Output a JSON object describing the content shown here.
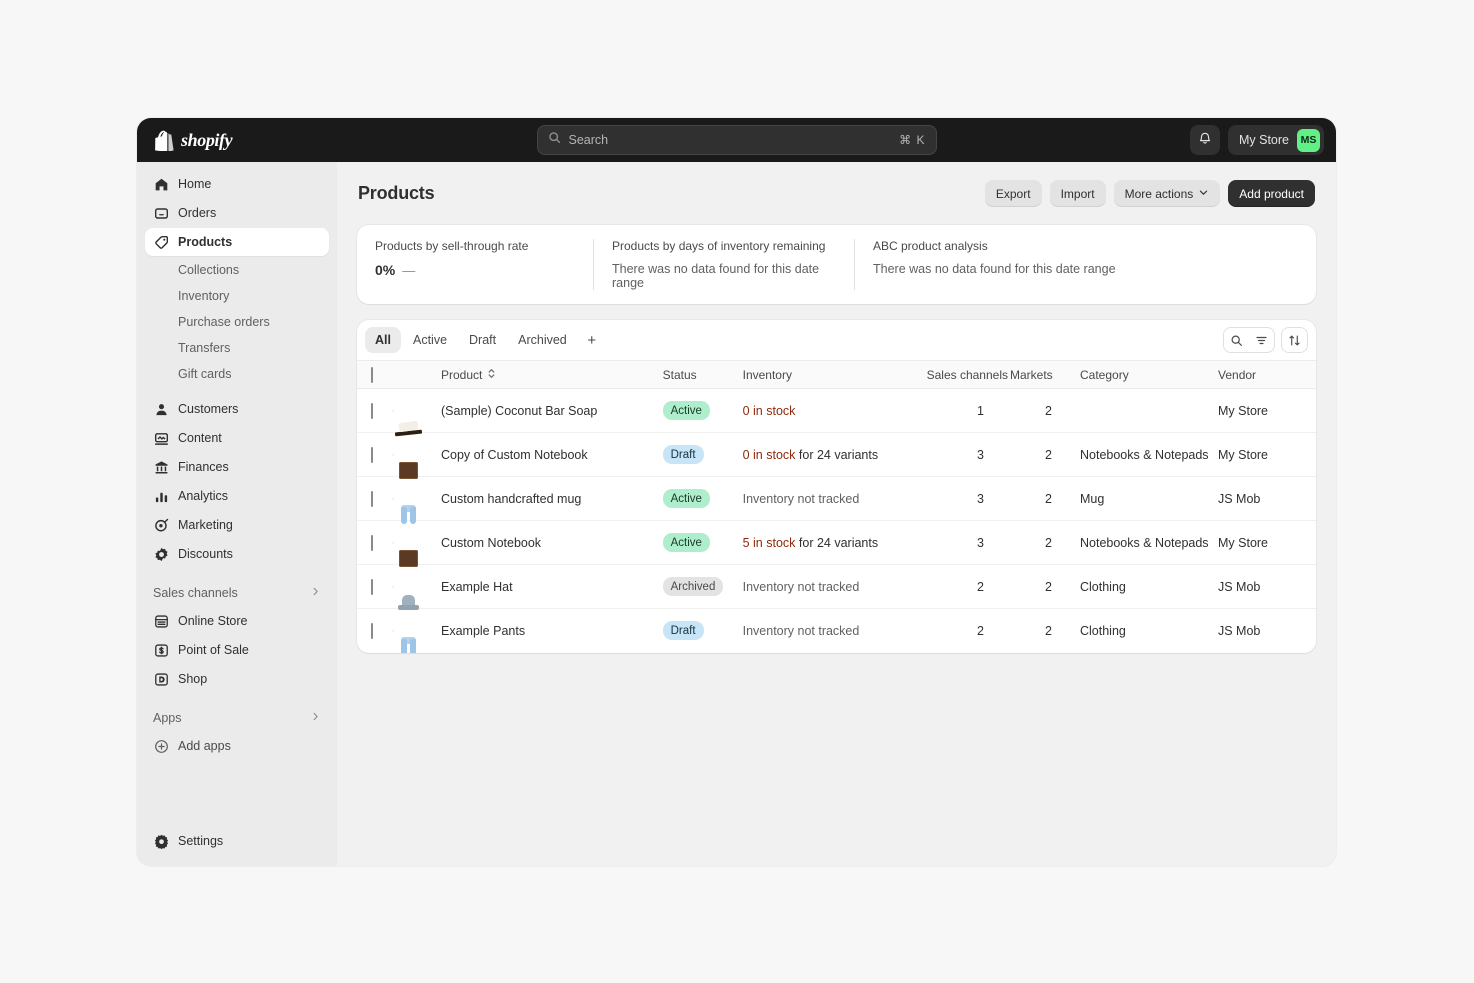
{
  "topbar": {
    "logo_text": "shopify",
    "search": {
      "placeholder": "Search",
      "shortcut": "⌘ K"
    },
    "store_name": "My Store",
    "store_initials": "MS"
  },
  "sidebar": {
    "primary": [
      {
        "label": "Home",
        "icon": "home-icon"
      },
      {
        "label": "Orders",
        "icon": "orders-icon"
      },
      {
        "label": "Products",
        "icon": "products-tag-icon",
        "active": true
      }
    ],
    "product_subitems": [
      {
        "label": "Collections"
      },
      {
        "label": "Inventory"
      },
      {
        "label": "Purchase orders"
      },
      {
        "label": "Transfers"
      },
      {
        "label": "Gift cards"
      }
    ],
    "secondary": [
      {
        "label": "Customers",
        "icon": "customers-icon"
      },
      {
        "label": "Content",
        "icon": "content-icon"
      },
      {
        "label": "Finances",
        "icon": "finances-bank-icon"
      },
      {
        "label": "Analytics",
        "icon": "analytics-bars-icon"
      },
      {
        "label": "Marketing",
        "icon": "marketing-target-icon"
      },
      {
        "label": "Discounts",
        "icon": "discounts-badge-icon"
      }
    ],
    "sales_channels_group": "Sales channels",
    "sales_channels": [
      {
        "label": "Online Store",
        "icon": "online-store-icon"
      },
      {
        "label": "Point of Sale",
        "icon": "point-of-sale-icon"
      },
      {
        "label": "Shop",
        "icon": "shop-icon"
      }
    ],
    "apps_group": "Apps",
    "add_apps": {
      "label": "Add apps",
      "icon": "plus-circle-icon"
    },
    "settings": {
      "label": "Settings",
      "icon": "gear-icon"
    }
  },
  "page": {
    "title": "Products",
    "actions": {
      "export": "Export",
      "import": "Import",
      "more_actions": "More actions",
      "add_product": "Add product"
    }
  },
  "metrics": [
    {
      "title": "Products by sell-through rate",
      "value": "0%",
      "dash": "—",
      "empty": ""
    },
    {
      "title": "Products by days of inventory remaining",
      "value": "",
      "dash": "",
      "empty": "There was no data found for this date range"
    },
    {
      "title": "ABC product analysis",
      "value": "",
      "dash": "",
      "empty": "There was no data found for this date range"
    }
  ],
  "tabs": [
    {
      "label": "All",
      "active": true
    },
    {
      "label": "Active",
      "active": false
    },
    {
      "label": "Draft",
      "active": false
    },
    {
      "label": "Archived",
      "active": false
    }
  ],
  "tab_add": "+",
  "table": {
    "columns": {
      "product": "Product",
      "status": "Status",
      "inventory": "Inventory",
      "sales_channels": "Sales channels",
      "markets": "Markets",
      "category": "Category",
      "vendor": "Vendor"
    },
    "rows": [
      {
        "name": "(Sample) Coconut Bar Soap",
        "status": "Active",
        "status_kind": "active",
        "inv_lead": "0 in stock",
        "inv_lead_kind": "critical",
        "inv_rest": "",
        "sales_channels": "1",
        "markets": "2",
        "category": "",
        "vendor": "My Store",
        "thumb": "soap"
      },
      {
        "name": "Copy of Custom Notebook",
        "status": "Draft",
        "status_kind": "draft",
        "inv_lead": "0 in stock",
        "inv_lead_kind": "critical",
        "inv_rest": " for 24 variants",
        "sales_channels": "3",
        "markets": "2",
        "category": "Notebooks & Notepads",
        "vendor": "My Store",
        "thumb": "notebook"
      },
      {
        "name": "Custom handcrafted mug",
        "status": "Active",
        "status_kind": "active",
        "inv_lead": "Inventory not tracked",
        "inv_lead_kind": "muted",
        "inv_rest": "",
        "sales_channels": "3",
        "markets": "2",
        "category": "Mug",
        "vendor": "JS Mob",
        "thumb": "jeans"
      },
      {
        "name": "Custom Notebook",
        "status": "Active",
        "status_kind": "active",
        "inv_lead": "5 in stock",
        "inv_lead_kind": "critical",
        "inv_rest": " for 24 variants",
        "sales_channels": "3",
        "markets": "2",
        "category": "Notebooks & Notepads",
        "vendor": "My Store",
        "thumb": "notebook"
      },
      {
        "name": "Example Hat",
        "status": "Archived",
        "status_kind": "archived",
        "inv_lead": "Inventory not tracked",
        "inv_lead_kind": "muted",
        "inv_rest": "",
        "sales_channels": "2",
        "markets": "2",
        "category": "Clothing",
        "vendor": "JS Mob",
        "thumb": "hat"
      },
      {
        "name": "Example Pants",
        "status": "Draft",
        "status_kind": "draft",
        "inv_lead": "Inventory not tracked",
        "inv_lead_kind": "muted",
        "inv_rest": "",
        "sales_channels": "2",
        "markets": "2",
        "category": "Clothing",
        "vendor": "JS Mob",
        "thumb": "jeans"
      }
    ]
  },
  "colors": {
    "topbar_bg": "#1a1a1a",
    "sidebar_bg": "#ebebeb",
    "canvas_bg": "#f1f1f1",
    "accent_avatar": "#61f086",
    "badge_active": "#aeeecd",
    "badge_draft": "#c8e5f7",
    "badge_archived": "#e3e3e3",
    "critical_text": "#8e2a0c",
    "primary_button": "#303030"
  }
}
